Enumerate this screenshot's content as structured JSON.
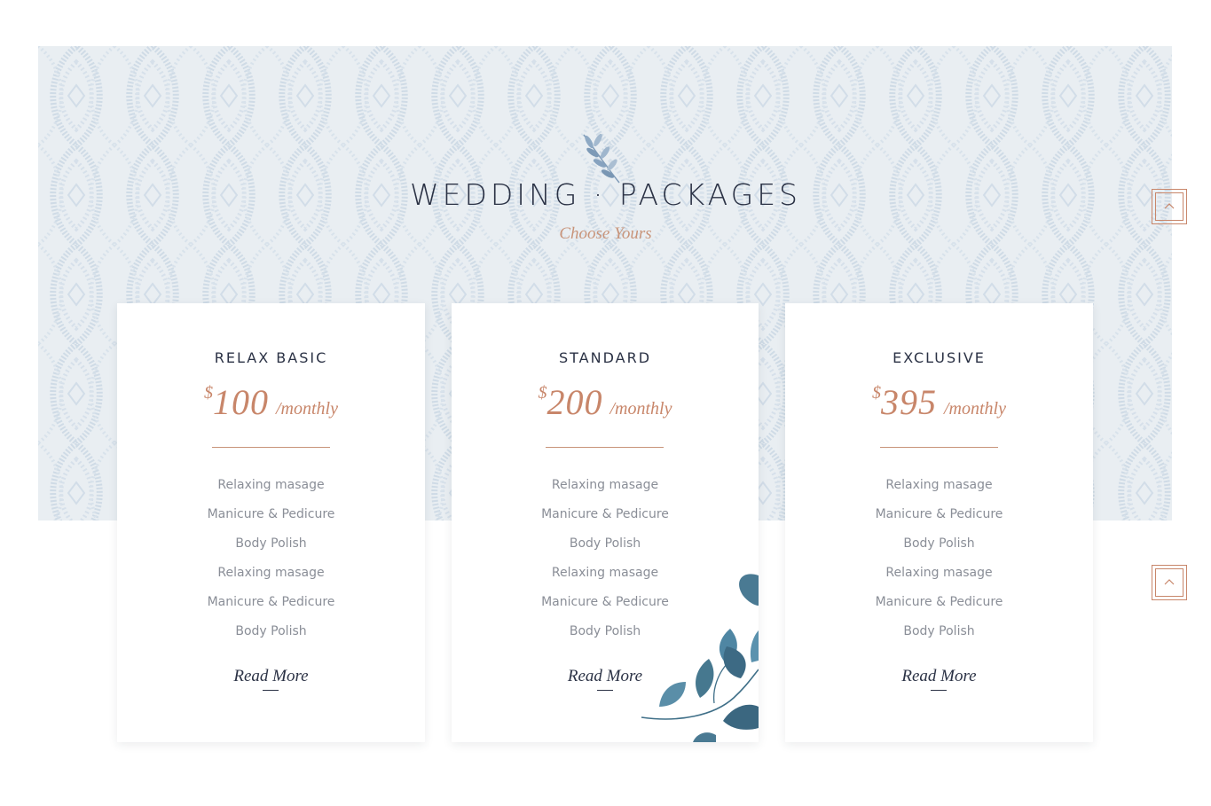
{
  "section": {
    "title": "WEDDING · PACKAGES",
    "subtitle": "Choose Yours"
  },
  "colors": {
    "accent": "#c8866a",
    "heading": "#2b3245",
    "text": "#8a8e97",
    "banner_bg": "#e9eef2",
    "leaf": "#4a7a93"
  },
  "icons": {
    "sprig": "leaf-sprig-icon",
    "scroll": "chevron-up-icon"
  },
  "packages": [
    {
      "name": "RELAX BASIC",
      "currency": "$",
      "amount": "100",
      "period": "/monthly",
      "features": [
        "Relaxing masage",
        "Manicure & Pedicure",
        "Body Polish",
        "Relaxing masage",
        "Manicure & Pedicure",
        "Body Polish"
      ],
      "cta": "Read More"
    },
    {
      "name": "STANDARD",
      "currency": "$",
      "amount": "200",
      "period": "/monthly",
      "features": [
        "Relaxing masage",
        "Manicure & Pedicure",
        "Body Polish",
        "Relaxing masage",
        "Manicure & Pedicure",
        "Body Polish"
      ],
      "cta": "Read More"
    },
    {
      "name": "EXCLUSIVE",
      "currency": "$",
      "amount": "395",
      "period": "/monthly",
      "features": [
        "Relaxing masage",
        "Manicure & Pedicure",
        "Body Polish",
        "Relaxing masage",
        "Manicure & Pedicure",
        "Body Polish"
      ],
      "cta": "Read More"
    }
  ]
}
